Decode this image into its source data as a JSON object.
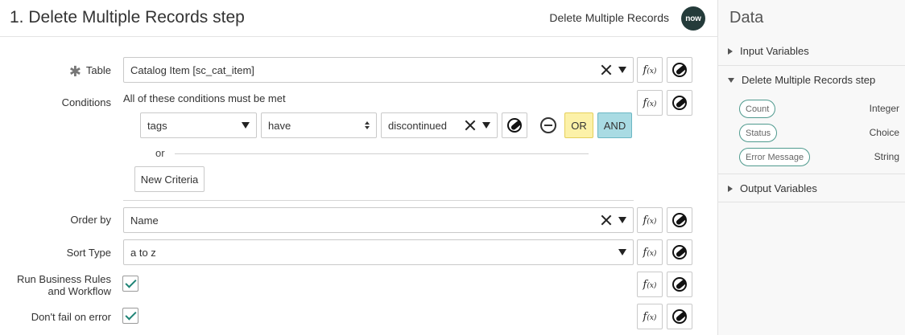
{
  "header": {
    "step_title": "1.  Delete Multiple Records step",
    "step_type": "Delete Multiple Records",
    "logo_text": "now"
  },
  "form": {
    "table": {
      "label": "Table",
      "value": "Catalog Item [sc_cat_item]",
      "required": true
    },
    "conditions": {
      "label": "Conditions",
      "summary": "All of these conditions must be met",
      "row": {
        "field": "tags",
        "operator": "have",
        "value": "discontinued"
      },
      "or_label": "OR",
      "and_label": "AND",
      "or_separator": "or",
      "new_criteria_label": "New Criteria"
    },
    "order_by": {
      "label": "Order by",
      "value": "Name"
    },
    "sort_type": {
      "label": "Sort Type",
      "value": "a to z"
    },
    "run_business_rules": {
      "label_line1": "Run Business Rules",
      "label_line2": "and Workflow",
      "checked": true
    },
    "dont_fail": {
      "label": "Don't fail on error",
      "checked": true
    },
    "fx_label": "f(x)"
  },
  "side": {
    "title": "Data",
    "input_variables": "Input Variables",
    "step_section": "Delete Multiple Records step",
    "variables": [
      {
        "name": "Count",
        "type": "Integer"
      },
      {
        "name": "Status",
        "type": "Choice"
      },
      {
        "name": "Error Message",
        "type": "String"
      }
    ],
    "output_variables": "Output Variables"
  },
  "colors": {
    "accent": "#1f8476",
    "or_bg": "#fcf1a8",
    "and_bg": "#a9dbe3",
    "logo_bg": "#243b3a"
  }
}
